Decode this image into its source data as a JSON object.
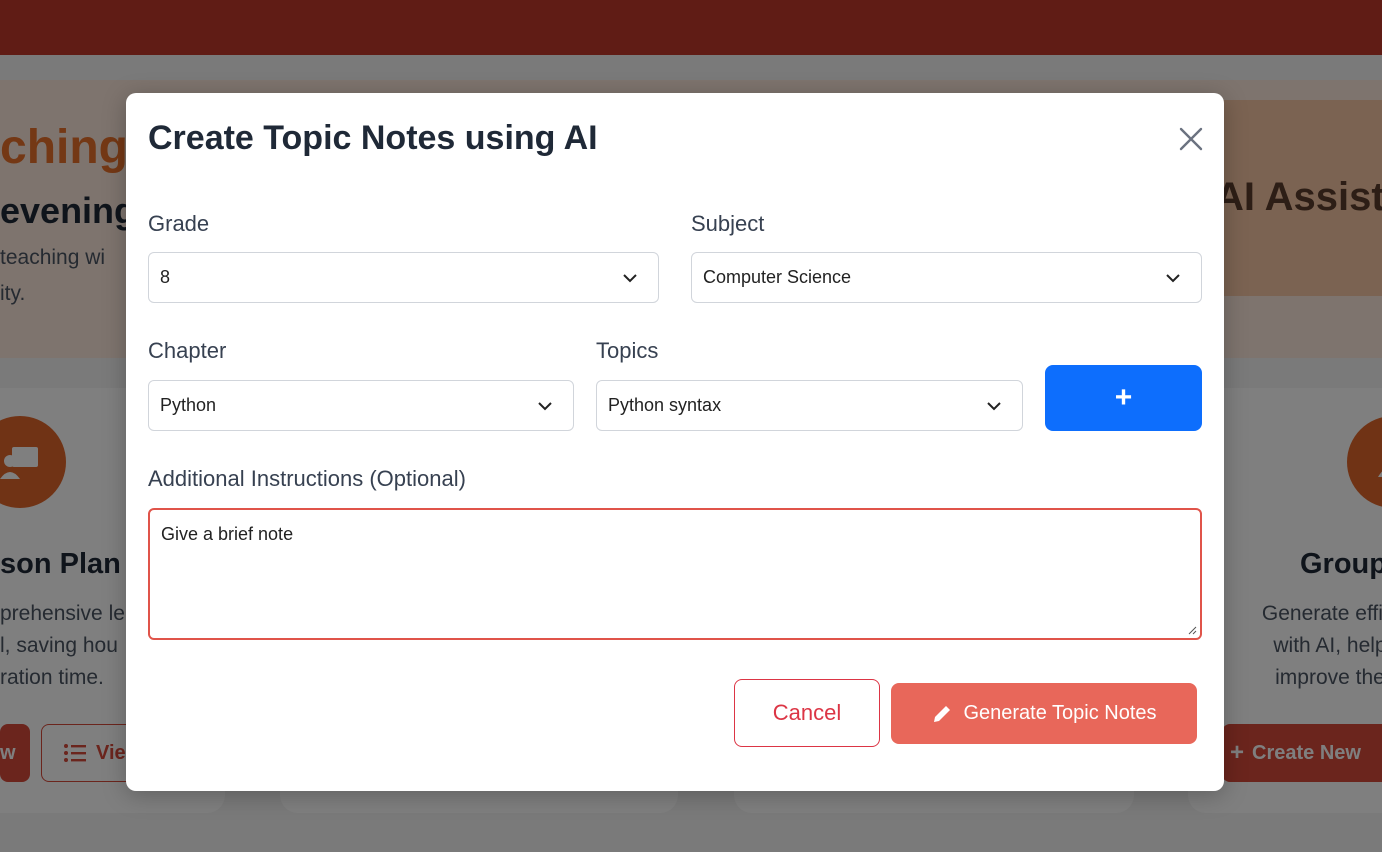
{
  "background": {
    "hero": {
      "title_fragment": "ching A",
      "greeting_fragment": "evening,",
      "subtitle_line1": "teaching wi",
      "subtitle_line2": "ity.",
      "right_title_fragment": "AI Assista"
    },
    "cards": [
      {
        "title_fragment": "son Plan",
        "desc_lines": [
          "prehensive le",
          "l, saving hou",
          "ration time."
        ],
        "primary_button_fragment": "w",
        "secondary_button_fragment": "Vie"
      },
      {
        "title_fragment": "Group",
        "desc_lines": [
          "Generate effici",
          "with AI, help",
          "improve the"
        ],
        "primary_button": "Create New"
      }
    ]
  },
  "modal": {
    "title": "Create Topic Notes using AI",
    "grade": {
      "label": "Grade",
      "value": "8"
    },
    "subject": {
      "label": "Subject",
      "value": "Computer Science"
    },
    "chapter": {
      "label": "Chapter",
      "value": "Python"
    },
    "topics": {
      "label": "Topics",
      "value": "Python syntax"
    },
    "add_button": "+",
    "instructions": {
      "label": "Additional Instructions (Optional)",
      "value": "Give a brief note"
    },
    "cancel_button": "Cancel",
    "generate_button": "Generate Topic Notes"
  },
  "colors": {
    "topbar": "#c0392b",
    "accent_orange": "#e0662b",
    "primary_blue": "#0d6efd",
    "generate_button": "#e8675a",
    "cancel_border": "#dc3545",
    "textarea_border": "#e0544a"
  }
}
